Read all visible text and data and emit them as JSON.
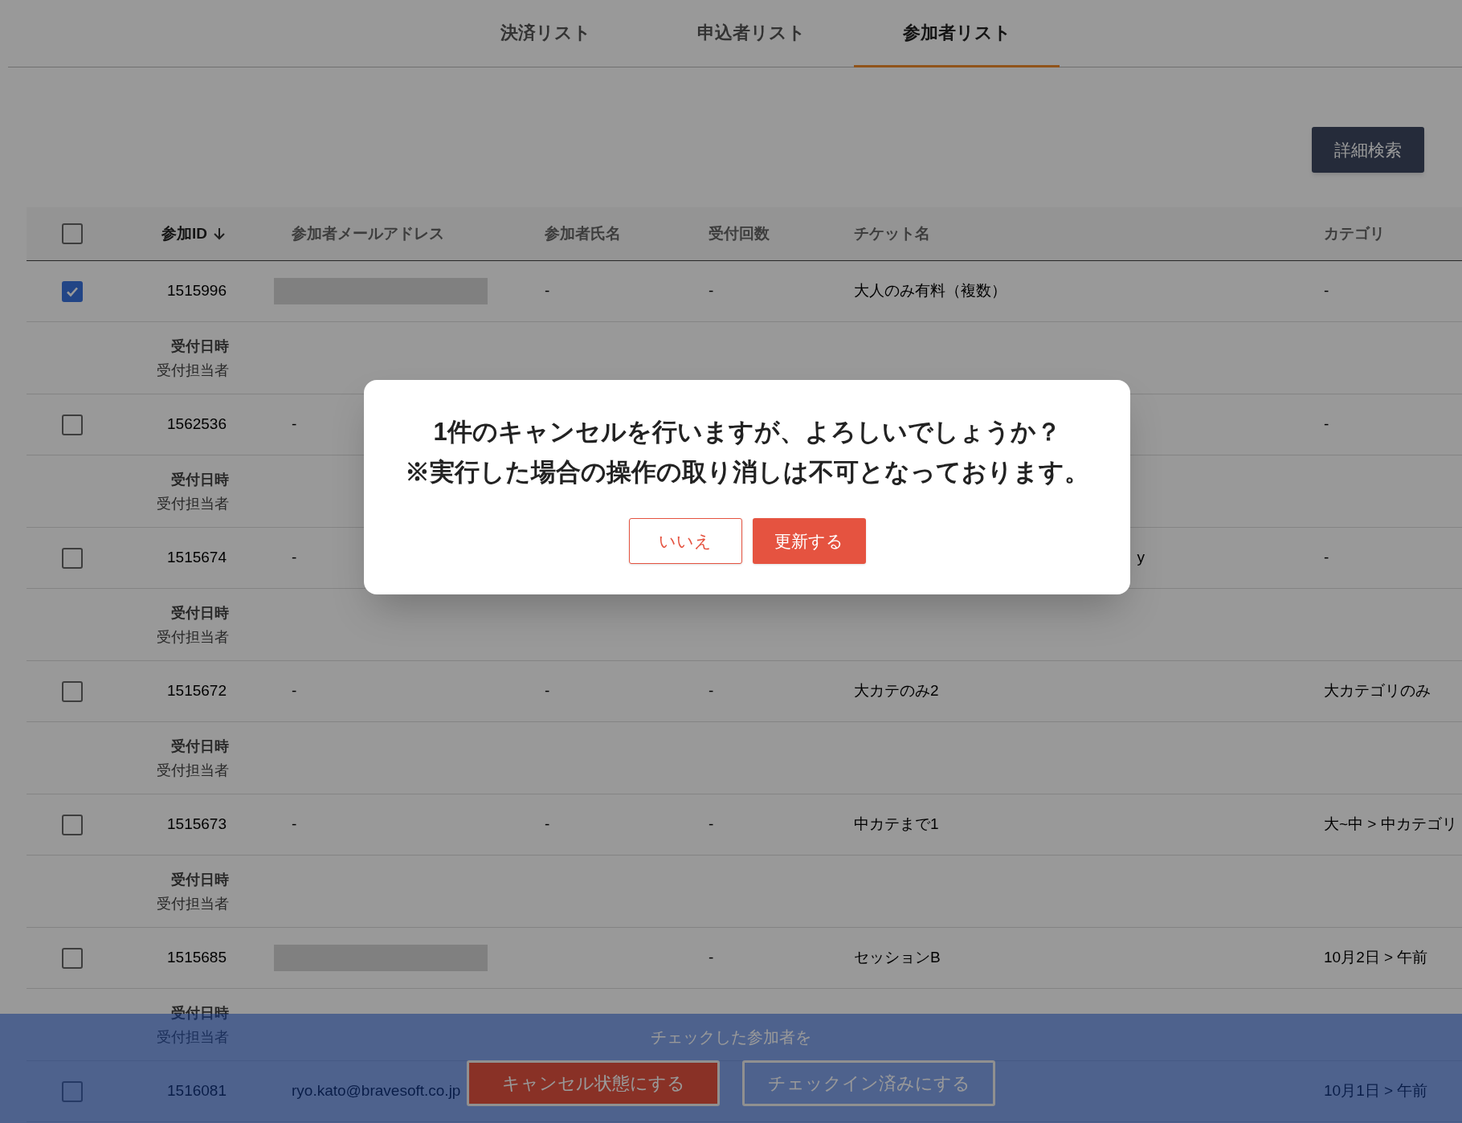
{
  "tabs": [
    {
      "label": "決済リスト",
      "selected": false
    },
    {
      "label": "申込者リスト",
      "selected": false
    },
    {
      "label": "参加者リスト",
      "selected": true
    }
  ],
  "search_button": "詳細検索",
  "table": {
    "select_all_checked": false,
    "columns": [
      {
        "label": "参加ID",
        "sorted": true
      },
      {
        "label": "参加者メールアドレス",
        "sorted": false
      },
      {
        "label": "参加者氏名",
        "sorted": false
      },
      {
        "label": "受付回数",
        "sorted": false
      },
      {
        "label": "チケット名",
        "sorted": false
      },
      {
        "label": "カテゴリ",
        "sorted": false
      }
    ],
    "rows": [
      {
        "checked": true,
        "id": "1515996",
        "email": {
          "kind": "redacted"
        },
        "name": "-",
        "count": "-",
        "ticket": "大人のみ有料（複数）",
        "category": "-",
        "sub_labels": [
          "受付日時",
          "受付担当者"
        ]
      },
      {
        "checked": false,
        "id": "1562536",
        "email": {
          "kind": "text",
          "text": "-"
        },
        "category": "-",
        "sub_labels": [
          "受付日時",
          "受付担当者"
        ]
      },
      {
        "checked": false,
        "id": "1515674",
        "email": {
          "kind": "text",
          "text": "-"
        },
        "ticket_tail": "y",
        "category": "-",
        "sub_labels": [
          "受付日時",
          "受付担当者"
        ]
      },
      {
        "checked": false,
        "id": "1515672",
        "email": {
          "kind": "text",
          "text": "-"
        },
        "name": "-",
        "count": "-",
        "ticket": "大カテのみ2",
        "category": "大カテゴリのみ",
        "sub_labels": [
          "受付日時",
          "受付担当者"
        ]
      },
      {
        "checked": false,
        "id": "1515673",
        "email": {
          "kind": "text",
          "text": "-"
        },
        "name": "-",
        "count": "-",
        "ticket": "中カテまで1",
        "category": "大~中 > 中カテゴリ",
        "sub_labels": [
          "受付日時",
          "受付担当者"
        ]
      },
      {
        "checked": false,
        "id": "1515685",
        "email": {
          "kind": "redacted"
        },
        "count": "-",
        "ticket": "セッションB",
        "category": "10月2日 > 午前",
        "sub_labels": [
          "受付日時",
          "受付担当者"
        ]
      },
      {
        "checked": false,
        "id": "1516081",
        "email": {
          "kind": "text",
          "text": "ryo.kato@bravesoft.co.jp"
        },
        "category": "10月1日 > 午前"
      }
    ]
  },
  "action_bar": {
    "label": "チェックした参加者を",
    "buttons": [
      {
        "label": "キャンセル状態にする",
        "kind": "danger"
      },
      {
        "label": "チェックイン済みにする",
        "kind": "outline"
      }
    ]
  },
  "dialog": {
    "lines": [
      "1件のキャンセルを行いますが、よろしいでしょうか？",
      "※実行した場合の操作の取り消しは不可となっております。"
    ],
    "buttons": [
      {
        "label": "いいえ",
        "kind": "outline"
      },
      {
        "label": "更新する",
        "kind": "danger"
      }
    ]
  }
}
